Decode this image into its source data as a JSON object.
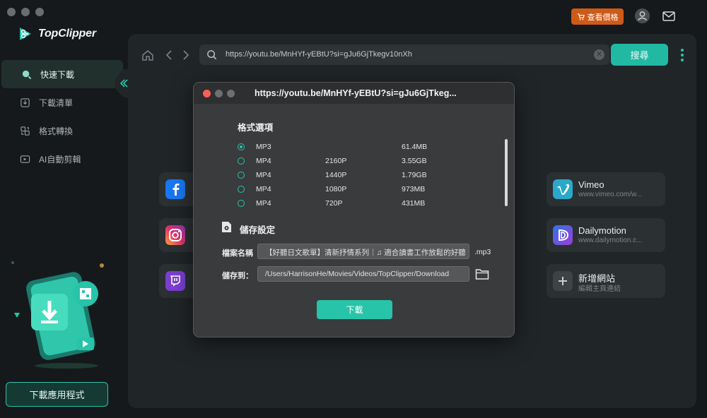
{
  "app": {
    "name": "TopClipper"
  },
  "topbar": {
    "price_label": "查看價格"
  },
  "sidebar": {
    "items": [
      {
        "label": "快速下載",
        "active": true
      },
      {
        "label": "下載清單",
        "active": false
      },
      {
        "label": "格式轉換",
        "active": false
      },
      {
        "label": "AI自動剪輯",
        "active": false
      }
    ],
    "download_app_label": "下載應用程式"
  },
  "browser": {
    "url": "https://youtu.be/MnHYf-yEBtU?si=gJu6GjTkegv10nXh",
    "search_label": "搜尋"
  },
  "sites": [
    {
      "title": "Vimeo",
      "sub": "www.vimeo.com/w...",
      "color": "#2aa8c9"
    },
    {
      "title": "Dailymotion",
      "sub": "www.dailymotion.c...",
      "color": "#4a5ad6"
    },
    {
      "title": "新增網站",
      "sub": "編輯主頁連結",
      "color": "#4a4f52"
    }
  ],
  "dialog": {
    "title": "https://youtu.be/MnHYf-yEBtU?si=gJu6GjTkeg...",
    "format_section": "格式選項",
    "formats": [
      {
        "type": "MP3",
        "res": "",
        "size": "61.4MB",
        "selected": true
      },
      {
        "type": "MP4",
        "res": "2160P",
        "size": "3.55GB",
        "selected": false
      },
      {
        "type": "MP4",
        "res": "1440P",
        "size": "1.79GB",
        "selected": false
      },
      {
        "type": "MP4",
        "res": "1080P",
        "size": "973MB",
        "selected": false
      },
      {
        "type": "MP4",
        "res": "720P",
        "size": "431MB",
        "selected": false
      }
    ],
    "save_section": "儲存設定",
    "filename_label": "檔案名稱",
    "filename_value": "【好聽日文歌單】清新抒情系列｜♫ 適合讀書工作放鬆的好聽",
    "filename_ext": ".mp3",
    "saveto_label": "儲存到：",
    "saveto_value": "/Users/HarrisonHe/Movies/Videos/TopClipper/Download",
    "download_label": "下載"
  }
}
